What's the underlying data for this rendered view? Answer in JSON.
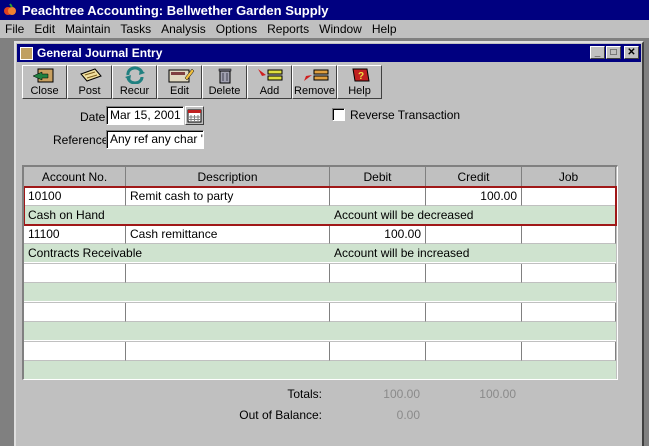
{
  "app": {
    "title": "Peachtree Accounting: Bellwether Garden Supply"
  },
  "menu": [
    {
      "label": "File"
    },
    {
      "label": "Edit"
    },
    {
      "label": "Maintain"
    },
    {
      "label": "Tasks"
    },
    {
      "label": "Analysis"
    },
    {
      "label": "Options"
    },
    {
      "label": "Reports"
    },
    {
      "label": "Window"
    },
    {
      "label": "Help"
    }
  ],
  "child_window": {
    "title": "General Journal Entry",
    "minimize_glyph": "_",
    "maximize_glyph": "□",
    "close_glyph": "✕"
  },
  "toolbar": [
    {
      "label": "Close",
      "icon": "close-icon"
    },
    {
      "label": "Post",
      "icon": "post-icon"
    },
    {
      "label": "Recur",
      "icon": "recur-icon"
    },
    {
      "label": "Edit",
      "icon": "edit-icon"
    },
    {
      "label": "Delete",
      "icon": "delete-icon"
    },
    {
      "label": "Add",
      "icon": "add-icon"
    },
    {
      "label": "Remove",
      "icon": "remove-icon"
    },
    {
      "label": "Help",
      "icon": "help-icon"
    }
  ],
  "form": {
    "date_label": "Date",
    "date_value": "Mar 15, 2001",
    "reference_label": "Reference",
    "reference_value": "Any ref any char \">",
    "reverse_label": "Reverse Transaction",
    "reverse_checked": false
  },
  "grid": {
    "columns": [
      "Account No.",
      "Description",
      "Debit",
      "Credit",
      "Job"
    ],
    "rows": [
      {
        "account": "10100",
        "description": "Remit cash to party",
        "debit": "",
        "credit": "100.00",
        "job": "",
        "account_name": "Cash on Hand",
        "effect": "Account will be decreased",
        "selected": true
      },
      {
        "account": "11100",
        "description": "Cash remittance",
        "debit": "100.00",
        "credit": "",
        "job": "",
        "account_name": "Contracts Receivable",
        "effect": "Account will be increased",
        "selected": false
      },
      {
        "account": "",
        "description": "",
        "debit": "",
        "credit": "",
        "job": "",
        "account_name": "",
        "effect": "",
        "selected": false
      },
      {
        "account": "",
        "description": "",
        "debit": "",
        "credit": "",
        "job": "",
        "account_name": "",
        "effect": "",
        "selected": false
      },
      {
        "account": "",
        "description": "",
        "debit": "",
        "credit": "",
        "job": "",
        "account_name": "",
        "effect": "",
        "selected": false
      }
    ]
  },
  "totals": {
    "totals_label": "Totals:",
    "debit_total": "100.00",
    "credit_total": "100.00",
    "out_of_balance_label": "Out of Balance:",
    "out_of_balance": "0.00"
  },
  "colors": {
    "titlebar": "#000080",
    "window_face": "#c0c0c0",
    "row_tint": "#cfe3cf",
    "selection_outline": "#a01818"
  }
}
